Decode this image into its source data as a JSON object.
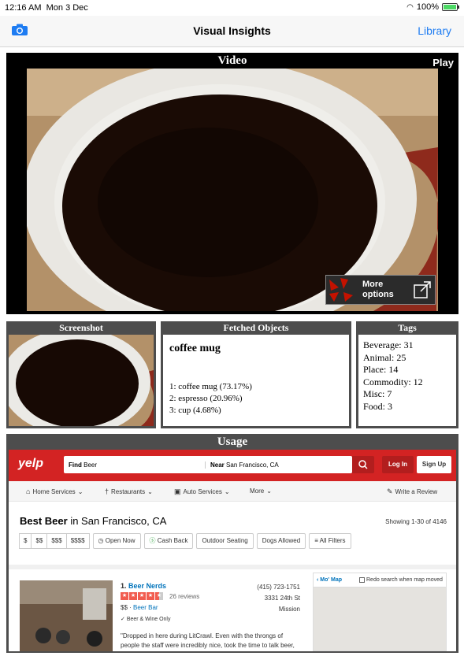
{
  "status": {
    "time": "12:16 AM",
    "date": "Mon 3 Dec",
    "battery": "100%"
  },
  "nav": {
    "title": "Visual Insights",
    "library": "Library",
    "camera_icon": "camera-icon"
  },
  "video": {
    "title": "Video",
    "play": "Play",
    "more_options": "More options"
  },
  "screenshot_panel": {
    "title": "Screenshot"
  },
  "fetched": {
    "title": "Fetched Objects",
    "top": "coffee mug",
    "results": [
      "1: coffee mug (73.17%)",
      "2: espresso (20.96%)",
      "3: cup (4.68%)"
    ]
  },
  "tags": {
    "title": "Tags",
    "items": [
      "Beverage: 31",
      "Animal: 25",
      "Place: 14",
      "Commodity: 12",
      "Misc: 7",
      "Food: 3"
    ]
  },
  "usage": {
    "title": "Usage",
    "yelp": {
      "logo": "yelp",
      "find_label": "Find",
      "find_value": "Beer",
      "near_label": "Near",
      "near_value": "San Francisco, CA",
      "login": "Log In",
      "signup": "Sign Up",
      "categories": [
        "Home Services",
        "Restaurants",
        "Auto Services",
        "More"
      ],
      "write_review": "Write a Review",
      "heading_bold": "Best Beer",
      "heading_rest": " in San Francisco, CA",
      "showing": "Showing 1-30 of 4146",
      "price_filters": [
        "$",
        "$$",
        "$$$",
        "$$$$"
      ],
      "filters": [
        "Open Now",
        "Cash Back",
        "Outdoor Seating",
        "Dogs Allowed",
        "All Filters"
      ],
      "result": {
        "number": "1.",
        "name": "Beer Nerds",
        "reviews": "26 reviews",
        "price": "$$",
        "category": "Beer Bar",
        "delivery": "Beer & Wine Only",
        "phone": "(415) 723-1751",
        "address": "3331 24th St",
        "neighborhood": "Mission",
        "quote": "\"Dropped in here during LitCrawl. Even with the throngs of people the staff were incredibly nice, took the time to talk beer,"
      },
      "map": {
        "label": "Mo' Map",
        "redo": "Redo search when map moved"
      }
    }
  }
}
